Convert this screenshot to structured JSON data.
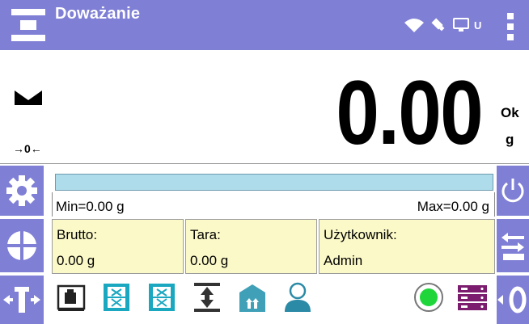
{
  "header": {
    "title": "Doważanie",
    "status_icons": [
      "wifi-icon",
      "pen-drive-icon",
      "computer-icon"
    ],
    "usb_label": "U"
  },
  "display": {
    "stability_icon": "stable-indicator-icon",
    "zero_indicator": "→0←",
    "weight": "0.00",
    "status": "Ok",
    "unit": "g"
  },
  "bargraph": {
    "fill_fraction": 0,
    "min_label": "Min=0.00 g",
    "max_label": "Max=0.00 g"
  },
  "info": [
    {
      "label": "Brutto:",
      "value": "0.00 g"
    },
    {
      "label": "Tara:",
      "value": "0.00 g"
    },
    {
      "label": "Użytkownik:",
      "value": "Admin"
    }
  ],
  "side_left": [
    "settings-gear-icon",
    "functions-pie-icon",
    "tare-icon"
  ],
  "side_right": [
    "power-icon",
    "print-icon",
    "zero-icon"
  ],
  "toolbar": [
    "weight-check-icon",
    "hide-tare-icon",
    "hide-tare-2-icon",
    "thresholds-icon",
    "packaging-icon",
    "user-icon",
    "status-green-icon",
    "database-icon"
  ],
  "colors": {
    "accent": "#7f7fd6",
    "bargraph": "#aedcea",
    "info_panel": "#fbf9c8",
    "teal_icon": "#1aa7c0",
    "status_green": "#1fd63a",
    "database": "#7b1c6e"
  }
}
